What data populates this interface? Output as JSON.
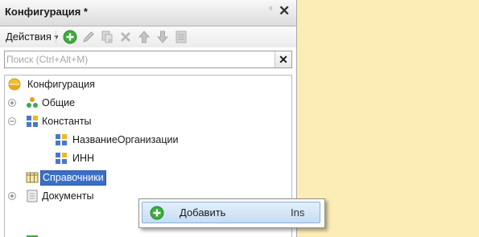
{
  "panel": {
    "title": "Конфигурация *",
    "pin_glyph": "⁰",
    "close_glyph": "✕"
  },
  "toolbar": {
    "actions_label": "Действия",
    "icons": [
      "add-icon",
      "edit-icon",
      "copy-icon",
      "delete-icon",
      "move-up-icon",
      "move-down-icon",
      "list-icon"
    ]
  },
  "search": {
    "placeholder": "Поиск (Ctrl+Alt+M)",
    "value": "",
    "clear_glyph": "✕"
  },
  "tree": {
    "root": "Конфигурация",
    "items": [
      {
        "label": "Общие",
        "expander": "plus"
      },
      {
        "label": "Константы",
        "expander": "minus"
      },
      {
        "label": "НазваниеОрганизации"
      },
      {
        "label": "ИНН"
      },
      {
        "label": "Справочники",
        "selected": true
      },
      {
        "label": "Документы",
        "expander": "plus"
      }
    ]
  },
  "context_menu": {
    "add_accel": "Д",
    "add_rest": "обавить",
    "add_shortcut": "Ins"
  },
  "colors": {
    "background": "#fbedb5",
    "selection": "#3a6fc7",
    "menu_highlight": "#c6ddf4",
    "add_green": "#3cae3c"
  }
}
